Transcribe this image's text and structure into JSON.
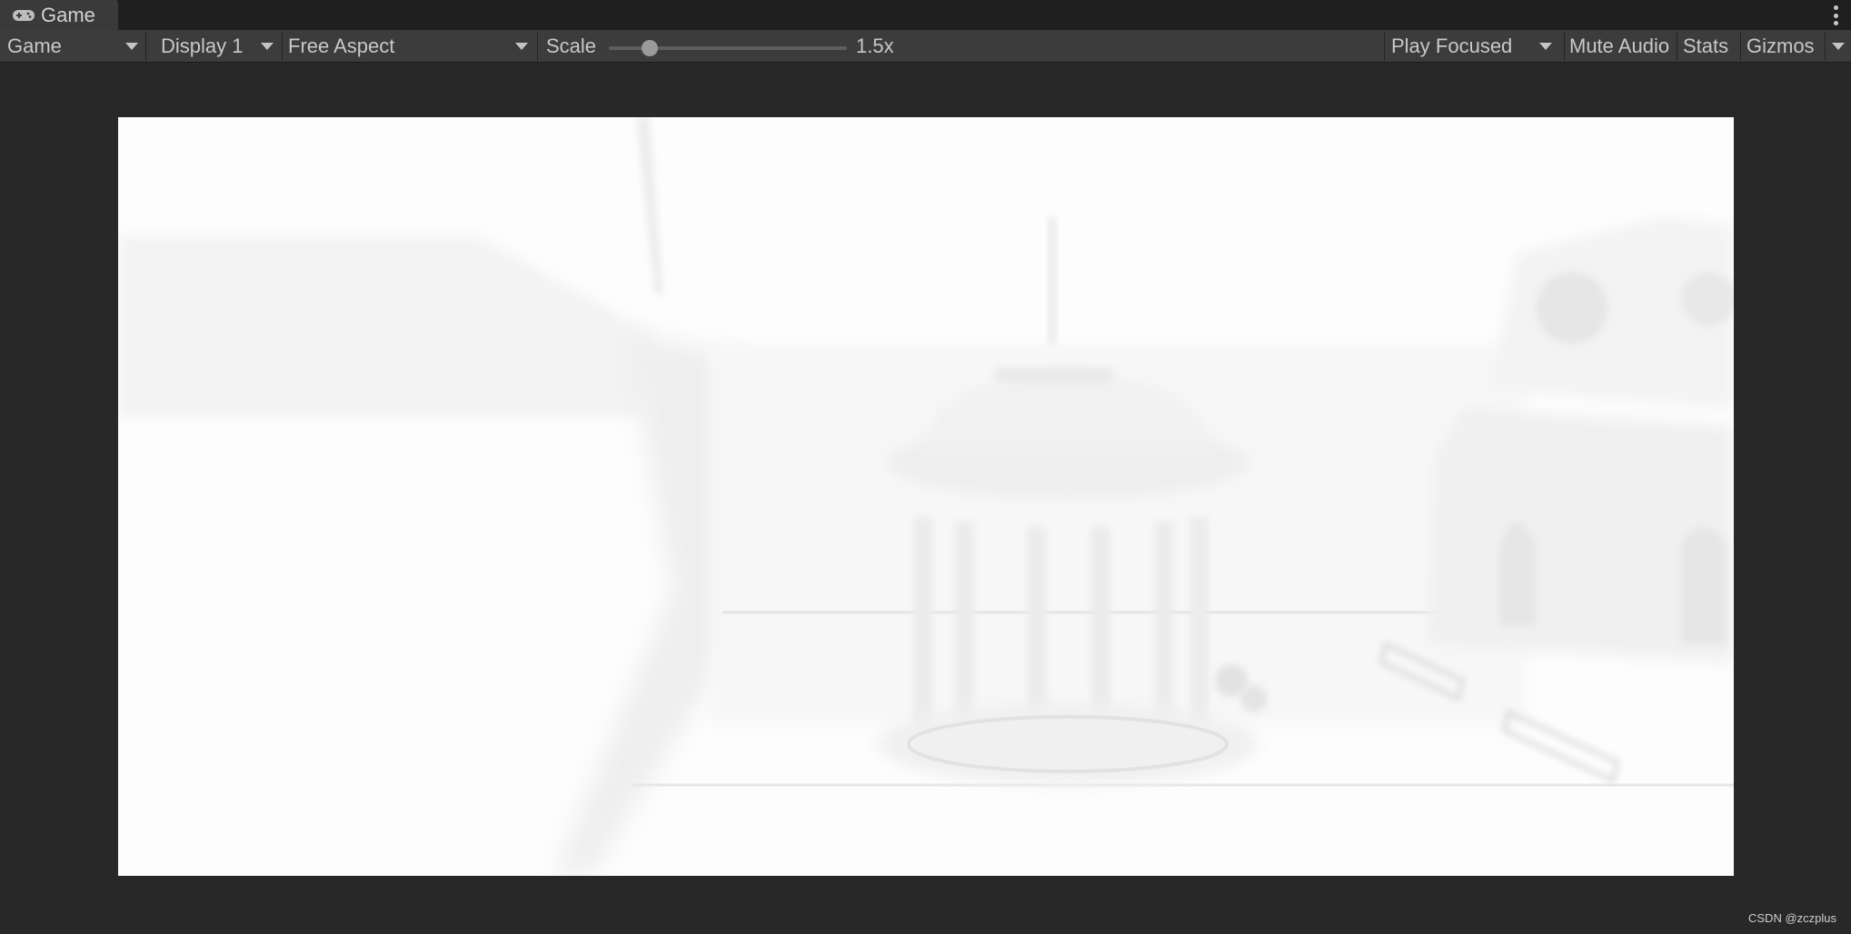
{
  "tab": {
    "label": "Game",
    "icon": "gamepad-icon"
  },
  "toolbar": {
    "view_select": "Game",
    "display_select": "Display 1",
    "aspect_select": "Free Aspect",
    "scale_label": "Scale",
    "scale_value": "1.5x",
    "scale_slider_fraction": 0.17,
    "play_mode_select": "Play Focused",
    "mute_audio": "Mute Audio",
    "stats": "Stats",
    "gizmos": "Gizmos"
  },
  "watermark": "CSDN @zczplus",
  "colors": {
    "editor_bg": "#282828",
    "toolbar_bg": "#3c3c3c",
    "tab_bg": "#3a3a3a",
    "scene_bg": "#fdfdfd",
    "text": "#c8c8c8"
  }
}
